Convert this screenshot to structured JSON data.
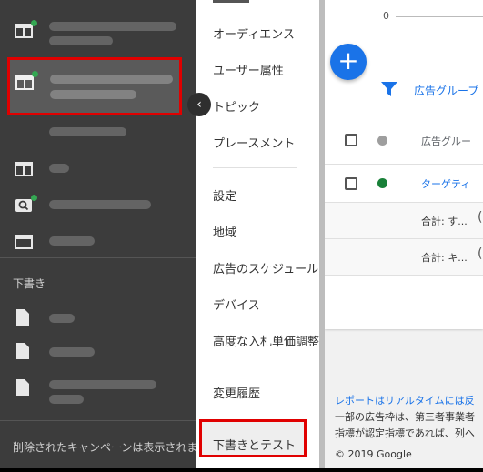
{
  "left_panel": {
    "drafts_label": "下書き",
    "hidden_campaigns_note": "削除されたキャンペーンは表示されま"
  },
  "menu": {
    "items": [
      "オーディエンス",
      "ユーザー属性",
      "トピック",
      "プレースメント",
      "設定",
      "地域",
      "広告のスケジュール",
      "デバイス",
      "高度な入札単価調整",
      "変更履歴",
      "下書きとテスト"
    ]
  },
  "content": {
    "axis_zero": "0",
    "fab_label": "+",
    "filter_text": "広告グループ",
    "header_col": "広告グルー",
    "row1_name": "ターゲティ",
    "total1": "合計: す...",
    "total2": "合計: キ...",
    "report_link": "レポートはリアルタイムには反",
    "note1": "一部の広告枠は、第三者事業者",
    "note2": "指標が認定指標であれば、列へ",
    "copyright": "© 2019 Google"
  },
  "colors": {
    "highlight": "#e00000",
    "link": "#1a73e8",
    "status_enabled": "#188038",
    "status_unknown": "#9e9e9e"
  }
}
